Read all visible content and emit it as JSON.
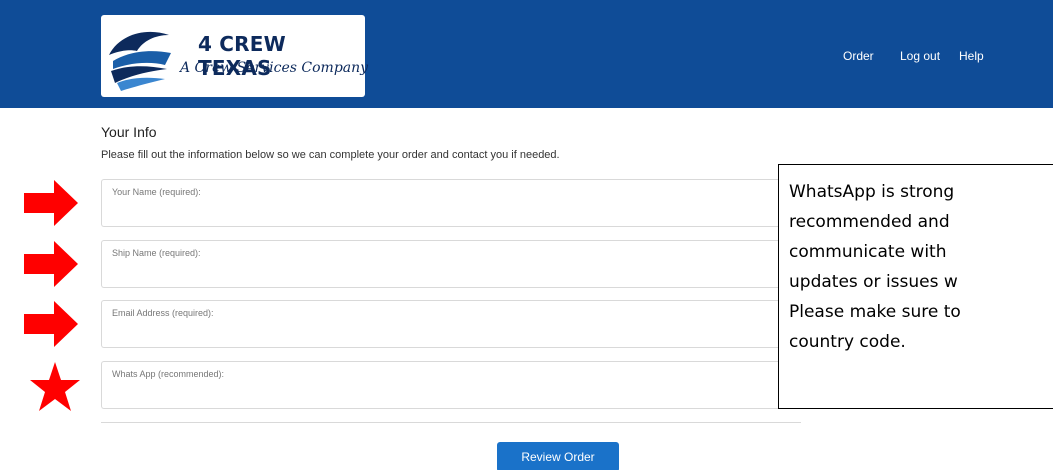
{
  "header": {
    "logo_title": "4 CREW TEXAS",
    "logo_subtitle": "A Crew Services Company",
    "nav": [
      "Order",
      "Log out",
      "Help"
    ],
    "background": "#0f4c97"
  },
  "form": {
    "section_title": "Your Info",
    "intro": "Please fill out the information below so we can complete your order and contact you if needed.",
    "fields": [
      {
        "label": "Your Name (required):",
        "value": ""
      },
      {
        "label": "Ship Name (required):",
        "value": ""
      },
      {
        "label": "Email Address (required):",
        "value": ""
      },
      {
        "label": "Whats App (recommended):",
        "value": ""
      }
    ],
    "submit_label": "Review Order"
  },
  "annotations": {
    "marker_color": "#ff0000",
    "markers": [
      "arrow-icon",
      "arrow-icon",
      "arrow-icon",
      "star-icon"
    ],
    "callout_lines": [
      "WhatsApp is strong",
      "recommended and",
      "communicate with",
      "updates or issues w",
      "Please make sure to",
      "country code."
    ]
  }
}
